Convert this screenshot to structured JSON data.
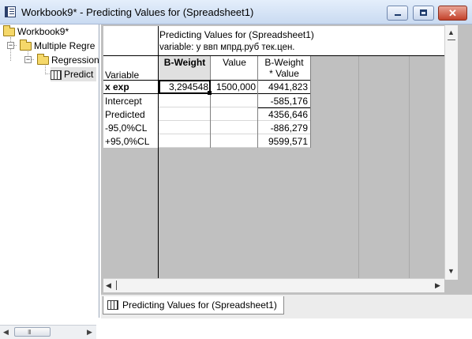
{
  "window": {
    "title": "Workbook9* - Predicting Values for (Spreadsheet1)",
    "close_glyph": "✕"
  },
  "tree": {
    "items": [
      {
        "label": "Workbook9*"
      },
      {
        "label": "Multiple Regre"
      },
      {
        "label": "Regression"
      },
      {
        "label": "Predict"
      }
    ],
    "scroll_grip": "III"
  },
  "sheet": {
    "title_line1": "Predicting Values for (Spreadsheet1)",
    "title_line2": "variable: у ввп мпрд.руб  тек.цен.",
    "row_header_label": "Variable",
    "columns": {
      "bweight": "B-Weight",
      "value": "Value",
      "bwv_line1": "B-Weight",
      "bwv_line2": "* Value"
    },
    "rows": [
      {
        "label": "x exp",
        "bweight": "3,294548",
        "value": "1500,000",
        "bwv": "4941,823"
      },
      {
        "label": "Intercept",
        "bweight": "",
        "value": "",
        "bwv": "-585,176"
      },
      {
        "label": "Predicted",
        "bweight": "",
        "value": "",
        "bwv": "4356,646"
      },
      {
        "label": "-95,0%CL",
        "bweight": "",
        "value": "",
        "bwv": "-886,279"
      },
      {
        "label": "+95,0%CL",
        "bweight": "",
        "value": "",
        "bwv": "9599,571"
      }
    ]
  },
  "tabs": [
    {
      "label": "Predicting Values for (Spreadsheet1)"
    }
  ]
}
